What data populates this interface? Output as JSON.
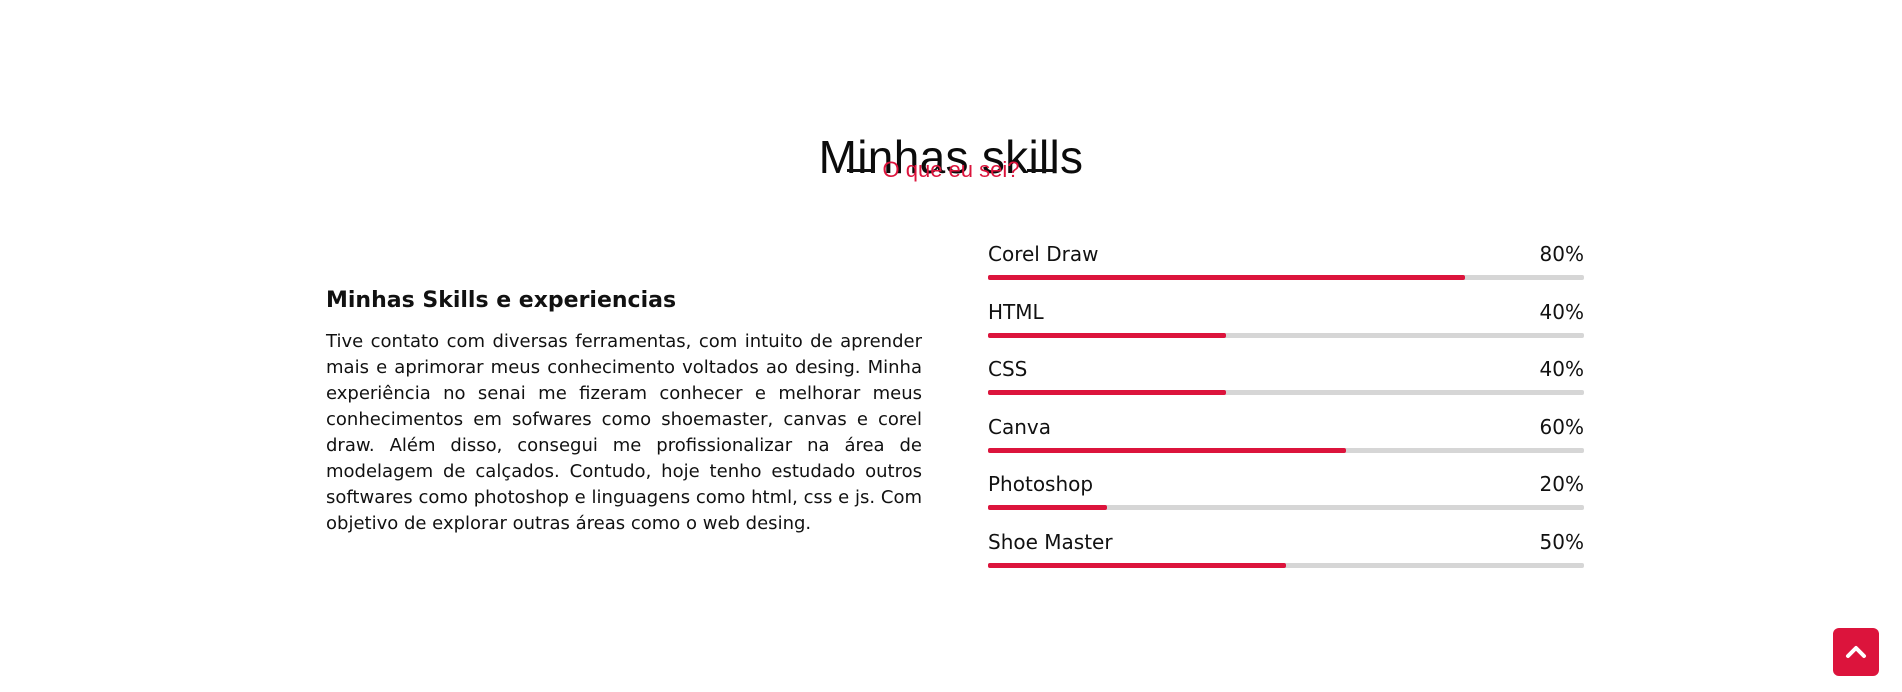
{
  "header": {
    "title": "Minhas skills",
    "subtitle": "O que eu sei?"
  },
  "about": {
    "heading": "Minhas Skills e experiencias",
    "text": "Tive contato com diversas ferramentas, com intuito de aprender mais e aprimorar meus conhecimento voltados ao desing. Minha experiência no senai me fizeram conhecer e melhorar meus conhecimentos em sofwares como shoemaster, canvas e corel draw. Além disso, consegui me profissionalizar na área de modelagem de calçados. Contudo, hoje tenho estudado outros softwares como photoshop e linguagens como html, css e js. Com objetivo de explorar outras áreas como o web desing."
  },
  "skills": [
    {
      "name": "Corel Draw",
      "percent_label": "80%",
      "level": 80
    },
    {
      "name": "HTML",
      "percent_label": "40%",
      "level": 40
    },
    {
      "name": "CSS",
      "percent_label": "40%",
      "level": 40
    },
    {
      "name": "Canva",
      "percent_label": "60%",
      "level": 60
    },
    {
      "name": "Photoshop",
      "percent_label": "20%",
      "level": 20
    },
    {
      "name": "Shoe Master",
      "percent_label": "50%",
      "level": 50
    }
  ],
  "colors": {
    "accent": "#dc143c",
    "track": "#d6d6d6",
    "text": "#111111",
    "background": "#ffffff"
  },
  "scroll_top_button": {
    "icon": "chevron-up-icon"
  }
}
